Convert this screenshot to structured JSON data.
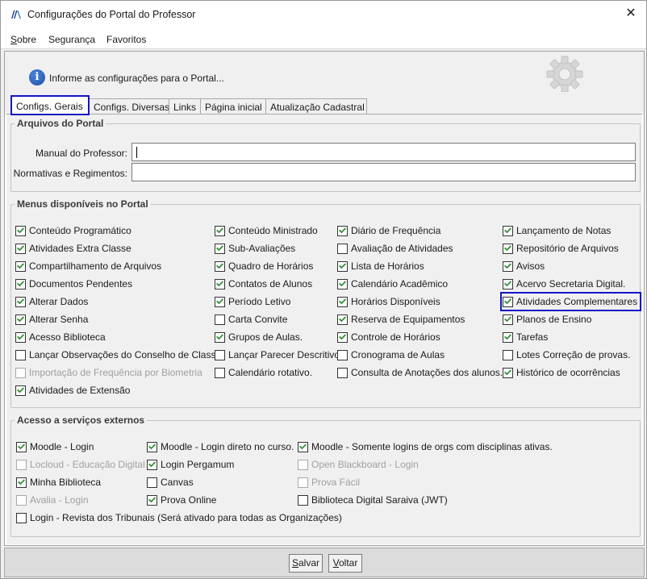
{
  "window": {
    "title": "Configurações do Portal do Professor",
    "close_glyph": "✕"
  },
  "menu": [
    {
      "label": "Sobre",
      "underline": "S"
    },
    {
      "label": "Segurança"
    },
    {
      "label": "Favoritos"
    }
  ],
  "info": {
    "icon_glyph": "i",
    "text": "Informe as configurações para o Portal..."
  },
  "tabs": [
    {
      "label": "Configs. Gerais",
      "active": true
    },
    {
      "label": "Configs. Diversas"
    },
    {
      "label": "Links"
    },
    {
      "label": "Página inicial"
    },
    {
      "label": "Atualização Cadastral"
    }
  ],
  "arquivos": {
    "title": "Arquivos do Portal",
    "manual_label": "Manual do Professor:",
    "manual_value": "",
    "normativas_label": "Normativas e Regimentos:",
    "normativas_value": ""
  },
  "menus": {
    "title": "Menus disponíveis no Portal",
    "columns": [
      [
        {
          "label": "Conteúdo Programático",
          "checked": true
        },
        {
          "label": "Atividades Extra Classe",
          "checked": true
        },
        {
          "label": "Compartilhamento de Arquivos",
          "checked": true
        },
        {
          "label": "Documentos Pendentes",
          "checked": true
        },
        {
          "label": "Alterar Dados",
          "checked": true
        },
        {
          "label": "Alterar Senha",
          "checked": true
        },
        {
          "label": "Acesso Biblioteca",
          "checked": true
        },
        {
          "label": "Lançar Observações do Conselho de Classe",
          "checked": false
        },
        {
          "label": "Importação de Frequência por Biometria",
          "checked": false,
          "disabled": true
        },
        {
          "label": "Atividades de Extensão",
          "checked": true
        }
      ],
      [
        {
          "label": "Conteúdo Ministrado",
          "checked": true
        },
        {
          "label": "Sub-Avaliações",
          "checked": true
        },
        {
          "label": "Quadro de Horários",
          "checked": true
        },
        {
          "label": "Contatos de Alunos",
          "checked": true
        },
        {
          "label": "Período Letivo",
          "checked": true
        },
        {
          "label": "Carta Convite",
          "checked": false
        },
        {
          "label": "Grupos de Aulas.",
          "checked": true
        },
        {
          "label": "Lançar Parecer Descritivo",
          "checked": false
        },
        {
          "label": "Calendário rotativo.",
          "checked": false
        }
      ],
      [
        {
          "label": "Diário de Frequência",
          "checked": true
        },
        {
          "label": "Avaliação de Atividades",
          "checked": false
        },
        {
          "label": "Lista de Horários",
          "checked": true
        },
        {
          "label": "Calendário Acadêmico",
          "checked": true
        },
        {
          "label": "Horários Disponíveis",
          "checked": true
        },
        {
          "label": "Reserva de Equipamentos",
          "checked": true
        },
        {
          "label": "Controle de Horários",
          "checked": true
        },
        {
          "label": "Cronograma de Aulas",
          "checked": false
        },
        {
          "label": "Consulta de Anotações dos alunos.",
          "checked": false
        }
      ],
      [
        {
          "label": "Lançamento de Notas",
          "checked": true
        },
        {
          "label": "Repositório de Arquivos",
          "checked": true
        },
        {
          "label": "Avisos",
          "checked": true
        },
        {
          "label": "Acervo Secretaria Digital.",
          "checked": true
        },
        {
          "label": "Atividades Complementares",
          "checked": true,
          "highlight": true
        },
        {
          "label": "Planos de Ensino",
          "checked": true
        },
        {
          "label": "Tarefas",
          "checked": true
        },
        {
          "label": "Lotes Correção de provas.",
          "checked": false
        },
        {
          "label": "Histórico de ocorrências",
          "checked": true
        }
      ]
    ]
  },
  "externos": {
    "title": "Acesso a serviços externos",
    "columns": [
      [
        {
          "label": "Moodle - Login",
          "checked": true
        },
        {
          "label": "Locloud - Educação Digital",
          "checked": false,
          "disabled": true
        },
        {
          "label": "Minha Biblioteca",
          "checked": true
        },
        {
          "label": "Avalia - Login",
          "checked": false,
          "disabled": true
        },
        {
          "label": "Login - Revista dos Tribunais (Será ativado para todas as Organizações)",
          "checked": false
        }
      ],
      [
        {
          "label": "Moodle - Login direto no curso.",
          "checked": true
        },
        {
          "label": "Login Pergamum",
          "checked": true
        },
        {
          "label": "Canvas",
          "checked": false
        },
        {
          "label": "Prova Online",
          "checked": true
        }
      ],
      [
        {
          "label": "Moodle - Somente logins de orgs com disciplinas ativas.",
          "checked": true
        },
        {
          "label": "Open Blackboard - Login",
          "checked": false,
          "disabled": true
        },
        {
          "label": "Prova Fácil",
          "checked": false,
          "disabled": true
        },
        {
          "label": "Biblioteca Digital Saraiva (JWT)",
          "checked": false
        }
      ]
    ]
  },
  "footer": {
    "save_label": "Salvar",
    "back_label": "Voltar"
  },
  "colors": {
    "highlight": "#1515c8",
    "check": "#2e8b2e"
  },
  "icons": [
    "app-logo-icon",
    "close-icon",
    "info-icon",
    "gear-icon",
    "checkbox-icon"
  ]
}
